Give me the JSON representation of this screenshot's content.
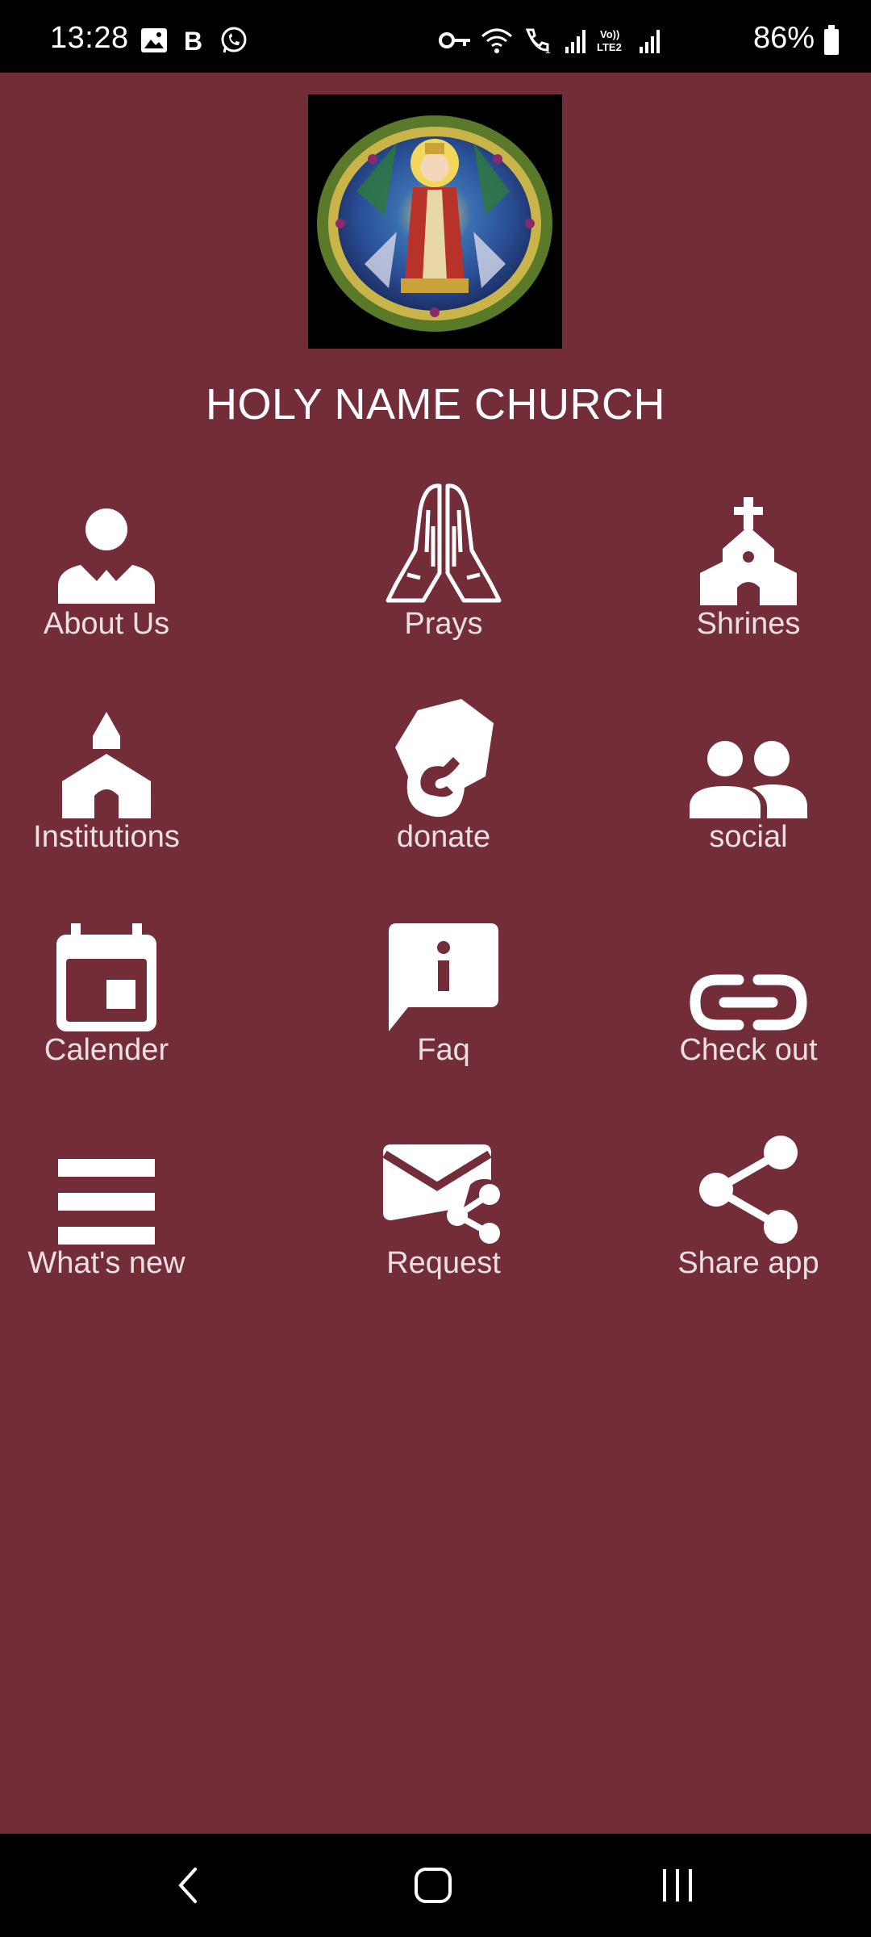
{
  "status_bar": {
    "time": "13:28",
    "left_icons": [
      "image-icon",
      "b-icon",
      "whatsapp-icon"
    ],
    "right_icons": [
      "vpn-key-icon",
      "wifi-icon",
      "call-icon",
      "signal-icon",
      "volte-icon",
      "signal-icon"
    ],
    "battery": "86%"
  },
  "header": {
    "title": "HOLY NAME CHURCH"
  },
  "menu": [
    {
      "label": "About Us",
      "icon": "person-icon"
    },
    {
      "label": "Prays",
      "icon": "praying-hands-icon"
    },
    {
      "label": "Shrines",
      "icon": "church-icon"
    },
    {
      "label": "Institutions",
      "icon": "institution-icon"
    },
    {
      "label": "donate",
      "icon": "donate-icon"
    },
    {
      "label": "social",
      "icon": "people-icon"
    },
    {
      "label": "Calender",
      "icon": "calendar-icon"
    },
    {
      "label": "Faq",
      "icon": "faq-icon"
    },
    {
      "label": "Check out",
      "icon": "link-icon"
    },
    {
      "label": "What's new",
      "icon": "menu-icon"
    },
    {
      "label": "Request",
      "icon": "mail-share-icon"
    },
    {
      "label": "Share app",
      "icon": "share-icon"
    }
  ],
  "colors": {
    "background": "#722d38",
    "icon": "#ffffff",
    "bars": "#000000"
  }
}
